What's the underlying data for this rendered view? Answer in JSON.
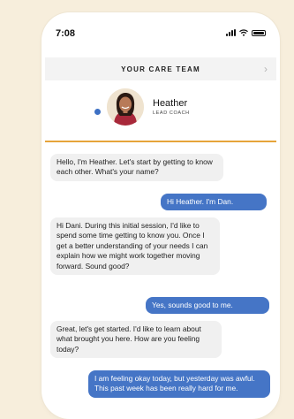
{
  "status": {
    "time": "7:08"
  },
  "header": {
    "title": "YOUR CARE TEAM"
  },
  "coach": {
    "name": "Heather",
    "role": "LEAD COACH"
  },
  "messages": [
    {
      "from": "coach",
      "text": "Hello, I'm Heather. Let's start by getting to know each other. What's your name?"
    },
    {
      "from": "user",
      "text": "Hi Heather. I'm Dan."
    },
    {
      "from": "coach",
      "text": "Hi Dani. During this initial session, I'd like to spend some time getting to know you. Once I get a better understanding of your needs I can explain how we might work together moving forward. Sound good?"
    },
    {
      "from": "user",
      "text": "Yes, sounds good to me."
    },
    {
      "from": "coach",
      "text": "Great, let's get started. I'd like to learn about what brought you here. How are you feeling today?"
    },
    {
      "from": "user",
      "text": "I am feeling okay today, but yesterday was awful. This past week has been really hard for me."
    }
  ],
  "colors": {
    "accent": "#4575c6",
    "divider": "#e6a43a",
    "background": "#f7eedc"
  }
}
